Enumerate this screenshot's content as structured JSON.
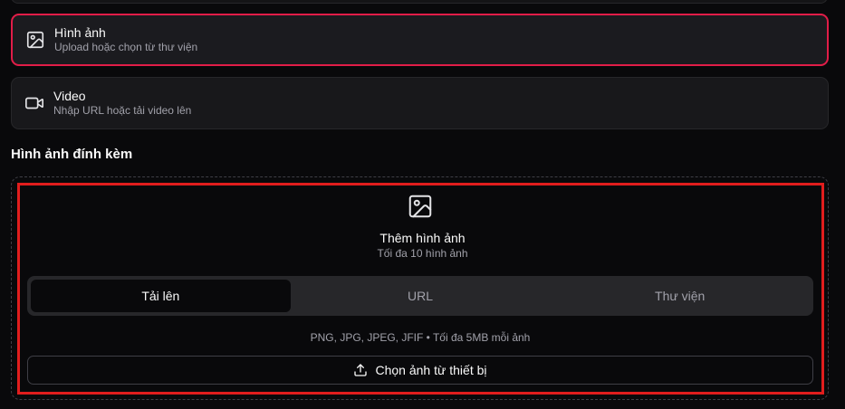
{
  "options": [
    {
      "title": "Hình ảnh",
      "subtitle": "Upload hoặc chọn từ thư viện",
      "icon": "image-icon",
      "selected": true
    },
    {
      "title": "Video",
      "subtitle": "Nhập URL hoặc tải video lên",
      "icon": "video-icon",
      "selected": false
    }
  ],
  "attachments": {
    "section_title": "Hình ảnh đính kèm",
    "add_title": "Thêm hình ảnh",
    "add_subtitle": "Tối đa 10 hình ảnh",
    "tabs": [
      {
        "label": "Tải lên",
        "active": true
      },
      {
        "label": "URL",
        "active": false
      },
      {
        "label": "Thư viện",
        "active": false
      }
    ],
    "formats": "PNG, JPG, JPEG, JFIF • Tối đa 5MB mỗi ảnh",
    "choose_label": "Chọn ảnh từ thiết bị"
  },
  "colors": {
    "accent": "#e11d48",
    "highlight": "#e11d1d",
    "background": "#09090b"
  }
}
